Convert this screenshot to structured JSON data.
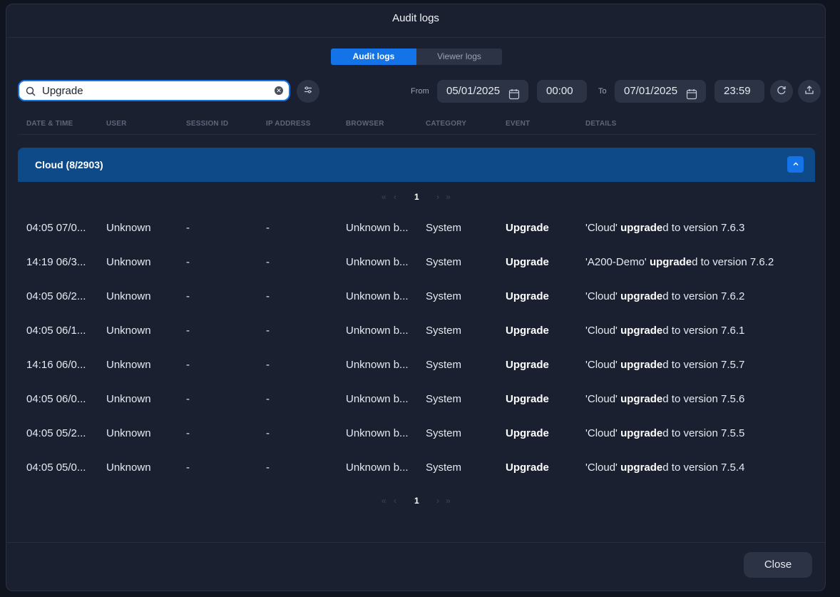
{
  "modal": {
    "title": "Audit logs"
  },
  "tabs": [
    {
      "label": "Audit logs",
      "active": true
    },
    {
      "label": "Viewer logs",
      "active": false
    }
  ],
  "search": {
    "value": "Upgrade",
    "placeholder": ""
  },
  "date_range": {
    "from_label": "From",
    "from_date": "05/01/2025",
    "from_time": "00:00",
    "to_label": "To",
    "to_date": "07/01/2025",
    "to_time": "23:59"
  },
  "columns": [
    "DATE & TIME",
    "USER",
    "SESSION ID",
    "IP ADDRESS",
    "BROWSER",
    "CATEGORY",
    "EVENT",
    "DETAILS"
  ],
  "group": {
    "title": "Cloud (8/2903)"
  },
  "pager": {
    "first": "«",
    "prev": "‹",
    "page": "1",
    "next": "›",
    "last": "»"
  },
  "rows": [
    {
      "datetime": "04:05 07/0...",
      "user": "Unknown",
      "session": "-",
      "ip": "-",
      "browser": "Unknown b...",
      "category": "System",
      "event": "Upgrade",
      "details_pre": "'Cloud' ",
      "details_bold": "upgrade",
      "details_post": "d to version 7.6.3"
    },
    {
      "datetime": "14:19 06/3...",
      "user": "Unknown",
      "session": "-",
      "ip": "-",
      "browser": "Unknown b...",
      "category": "System",
      "event": "Upgrade",
      "details_pre": "'A200-Demo' ",
      "details_bold": "upgrade",
      "details_post": "d to version 7.6.2"
    },
    {
      "datetime": "04:05 06/2...",
      "user": "Unknown",
      "session": "-",
      "ip": "-",
      "browser": "Unknown b...",
      "category": "System",
      "event": "Upgrade",
      "details_pre": "'Cloud' ",
      "details_bold": "upgrade",
      "details_post": "d to version 7.6.2"
    },
    {
      "datetime": "04:05 06/1...",
      "user": "Unknown",
      "session": "-",
      "ip": "-",
      "browser": "Unknown b...",
      "category": "System",
      "event": "Upgrade",
      "details_pre": "'Cloud' ",
      "details_bold": "upgrade",
      "details_post": "d to version 7.6.1"
    },
    {
      "datetime": "14:16 06/0...",
      "user": "Unknown",
      "session": "-",
      "ip": "-",
      "browser": "Unknown b...",
      "category": "System",
      "event": "Upgrade",
      "details_pre": "'Cloud' ",
      "details_bold": "upgrade",
      "details_post": "d to version 7.5.7"
    },
    {
      "datetime": "04:05 06/0...",
      "user": "Unknown",
      "session": "-",
      "ip": "-",
      "browser": "Unknown b...",
      "category": "System",
      "event": "Upgrade",
      "details_pre": "'Cloud' ",
      "details_bold": "upgrade",
      "details_post": "d to version 7.5.6"
    },
    {
      "datetime": "04:05 05/2...",
      "user": "Unknown",
      "session": "-",
      "ip": "-",
      "browser": "Unknown b...",
      "category": "System",
      "event": "Upgrade",
      "details_pre": "'Cloud' ",
      "details_bold": "upgrade",
      "details_post": "d to version 7.5.5"
    },
    {
      "datetime": "04:05 05/0...",
      "user": "Unknown",
      "session": "-",
      "ip": "-",
      "browser": "Unknown b...",
      "category": "System",
      "event": "Upgrade",
      "details_pre": "'Cloud' ",
      "details_bold": "upgrade",
      "details_post": "d to version 7.5.4"
    }
  ],
  "footer": {
    "close_label": "Close"
  },
  "colors": {
    "accent": "#1473e6",
    "group_bg": "#0e4a87",
    "modal_bg": "#1a2030"
  }
}
